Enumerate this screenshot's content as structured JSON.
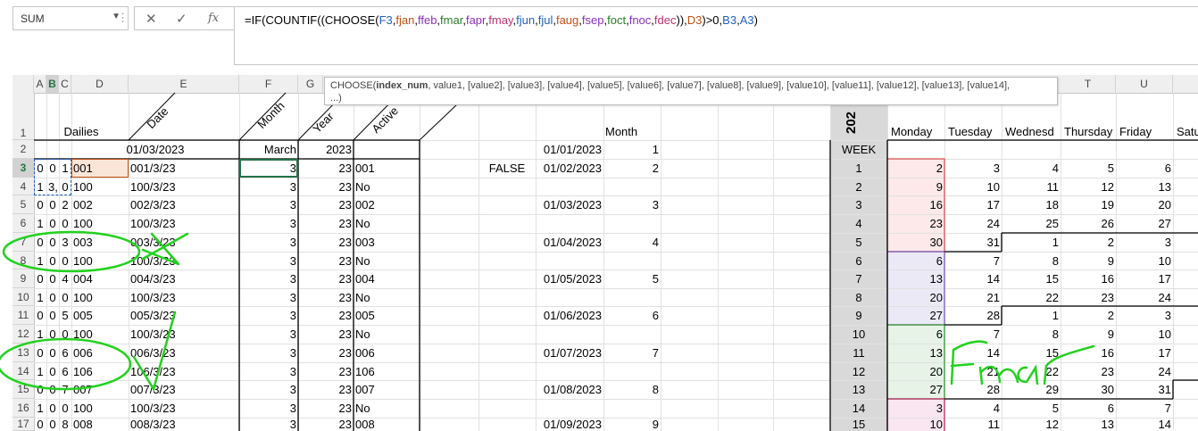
{
  "namebox": {
    "value": "SUM"
  },
  "formula_bar": {
    "cancel_icon": "✕",
    "enter_icon": "✓",
    "fx_label": "fx",
    "formula_parts": [
      {
        "t": "=IF(COUNTIF((CHOOSE(",
        "c": "#000"
      },
      {
        "t": "F3",
        "c": "#1f5fbf"
      },
      {
        "t": ",",
        "c": "#000"
      },
      {
        "t": "fjan",
        "c": "#c04f15"
      },
      {
        "t": ",",
        "c": "#000"
      },
      {
        "t": "ffeb",
        "c": "#8a2fbf"
      },
      {
        "t": ",",
        "c": "#000"
      },
      {
        "t": "fmar",
        "c": "#2a7a2a"
      },
      {
        "t": ",",
        "c": "#000"
      },
      {
        "t": "fapr",
        "c": "#8a2fbf"
      },
      {
        "t": ",",
        "c": "#000"
      },
      {
        "t": "fmay",
        "c": "#c0306b"
      },
      {
        "t": ",",
        "c": "#000"
      },
      {
        "t": "fjun",
        "c": "#1f5fbf"
      },
      {
        "t": ",",
        "c": "#000"
      },
      {
        "t": "fjul",
        "c": "#1f5fbf"
      },
      {
        "t": ",",
        "c": "#000"
      },
      {
        "t": "faug",
        "c": "#c04f15"
      },
      {
        "t": ",",
        "c": "#000"
      },
      {
        "t": "fsep",
        "c": "#8a2fbf"
      },
      {
        "t": ",",
        "c": "#000"
      },
      {
        "t": "foct",
        "c": "#2a7a2a"
      },
      {
        "t": ",",
        "c": "#000"
      },
      {
        "t": "fnoc",
        "c": "#8a2fbf"
      },
      {
        "t": ",",
        "c": "#000"
      },
      {
        "t": "fdec",
        "c": "#c0306b"
      },
      {
        "t": ")),",
        "c": "#000"
      },
      {
        "t": "D3",
        "c": "#c04f15"
      },
      {
        "t": ")>0,",
        "c": "#000"
      },
      {
        "t": "B3",
        "c": "#1f5fbf"
      },
      {
        "t": ",",
        "c": "#000"
      },
      {
        "t": "A3",
        "c": "#1f5fbf"
      },
      {
        "t": ")",
        "c": "#000"
      }
    ]
  },
  "tooltip": {
    "line1_fn": "CHOOSE(",
    "line1_bold": "index_num",
    "line1_rest": ", value1, [value2], [value3], [value4], [value5], [value6], [value7], [value8], [value9], [value10], [value11], [value12], [value13], [value14],",
    "line2": "...)"
  },
  "columns": [
    "A",
    "B",
    "C",
    "D",
    "E",
    "F",
    "G",
    "T",
    "U"
  ],
  "header_row": {
    "dailies": "Dailies",
    "date": "Date",
    "month": "Month",
    "year": "Year",
    "active": "Active",
    "month2": "Month",
    "year_vertical": "202",
    "weekdays": [
      "Monday",
      "Tuesday",
      "Wednesd",
      "Thursday",
      "Friday",
      "Satu"
    ]
  },
  "row2": {
    "date": "01/03/2023",
    "month": "March",
    "year": "2023",
    "ref_date": "01/01/2023",
    "ref_month": "1",
    "week": "WEEK"
  },
  "rows": [
    {
      "n": "3",
      "a": "0",
      "b": "0",
      "c": "1",
      "d": "001",
      "e": "001/3/23",
      "f": "3",
      "g": "23",
      "h": "001",
      "i": "FALSE",
      "j": "01/02/2023",
      "k": "2"
    },
    {
      "n": "4",
      "a": "1",
      "b": "3,",
      "c": "0",
      "d": "100",
      "e": "100/3/23",
      "f": "3",
      "g": "23",
      "h": "No",
      "i": "",
      "j": "",
      "k": ""
    },
    {
      "n": "5",
      "a": "0",
      "b": "0",
      "c": "2",
      "d": "002",
      "e": "002/3/23",
      "f": "3",
      "g": "23",
      "h": "002",
      "i": "",
      "j": "01/03/2023",
      "k": "3"
    },
    {
      "n": "6",
      "a": "1",
      "b": "0",
      "c": "0",
      "d": "100",
      "e": "100/3/23",
      "f": "3",
      "g": "23",
      "h": "No",
      "i": "",
      "j": "",
      "k": ""
    },
    {
      "n": "7",
      "a": "0",
      "b": "0",
      "c": "3",
      "d": "003",
      "e": "003/3/23",
      "f": "3",
      "g": "23",
      "h": "003",
      "i": "",
      "j": "01/04/2023",
      "k": "4"
    },
    {
      "n": "8",
      "a": "1",
      "b": "0",
      "c": "0",
      "d": "100",
      "e": "100/3/23",
      "f": "3",
      "g": "23",
      "h": "No",
      "i": "",
      "j": "",
      "k": ""
    },
    {
      "n": "9",
      "a": "0",
      "b": "0",
      "c": "4",
      "d": "004",
      "e": "004/3/23",
      "f": "3",
      "g": "23",
      "h": "004",
      "i": "",
      "j": "01/05/2023",
      "k": "5"
    },
    {
      "n": "10",
      "a": "1",
      "b": "0",
      "c": "0",
      "d": "100",
      "e": "100/3/23",
      "f": "3",
      "g": "23",
      "h": "No",
      "i": "",
      "j": "",
      "k": ""
    },
    {
      "n": "11",
      "a": "0",
      "b": "0",
      "c": "5",
      "d": "005",
      "e": "005/3/23",
      "f": "3",
      "g": "23",
      "h": "005",
      "i": "",
      "j": "01/06/2023",
      "k": "6"
    },
    {
      "n": "12",
      "a": "1",
      "b": "0",
      "c": "0",
      "d": "100",
      "e": "100/3/23",
      "f": "3",
      "g": "23",
      "h": "No",
      "i": "",
      "j": "",
      "k": ""
    },
    {
      "n": "13",
      "a": "0",
      "b": "0",
      "c": "6",
      "d": "006",
      "e": "006/3/23",
      "f": "3",
      "g": "23",
      "h": "006",
      "i": "",
      "j": "01/07/2023",
      "k": "7"
    },
    {
      "n": "14",
      "a": "1",
      "b": "0",
      "c": "6",
      "d": "106",
      "e": "106/3/23",
      "f": "3",
      "g": "23",
      "h": "106",
      "i": "",
      "j": "",
      "k": ""
    },
    {
      "n": "15",
      "a": "0",
      "b": "0",
      "c": "7",
      "d": "007",
      "e": "007/3/23",
      "f": "3",
      "g": "23",
      "h": "007",
      "i": "",
      "j": "01/08/2023",
      "k": "8"
    },
    {
      "n": "16",
      "a": "1",
      "b": "0",
      "c": "0",
      "d": "100",
      "e": "100/3/23",
      "f": "3",
      "g": "23",
      "h": "No",
      "i": "",
      "j": "",
      "k": ""
    },
    {
      "n": "17",
      "a": "0",
      "b": "0",
      "c": "8",
      "d": "008",
      "e": "008/3/23",
      "f": "3",
      "g": "23",
      "h": "008",
      "i": "",
      "j": "01/09/2023",
      "k": "9"
    }
  ],
  "calendar": [
    {
      "w": "1",
      "d": [
        "2",
        "3",
        "4",
        "5",
        "6"
      ]
    },
    {
      "w": "2",
      "d": [
        "9",
        "10",
        "11",
        "12",
        "13"
      ]
    },
    {
      "w": "3",
      "d": [
        "16",
        "17",
        "18",
        "19",
        "20"
      ]
    },
    {
      "w": "4",
      "d": [
        "23",
        "24",
        "25",
        "26",
        "27"
      ]
    },
    {
      "w": "5",
      "d": [
        "30",
        "31",
        "1",
        "2",
        "3"
      ]
    },
    {
      "w": "6",
      "d": [
        "6",
        "7",
        "8",
        "9",
        "10"
      ]
    },
    {
      "w": "7",
      "d": [
        "13",
        "14",
        "15",
        "16",
        "17"
      ]
    },
    {
      "w": "8",
      "d": [
        "20",
        "21",
        "22",
        "23",
        "24"
      ]
    },
    {
      "w": "9",
      "d": [
        "27",
        "28",
        "1",
        "2",
        "3"
      ]
    },
    {
      "w": "10",
      "d": [
        "6",
        "7",
        "8",
        "9",
        "10"
      ]
    },
    {
      "w": "11",
      "d": [
        "13",
        "14",
        "15",
        "16",
        "17"
      ]
    },
    {
      "w": "12",
      "d": [
        "20",
        "21",
        "22",
        "23",
        "24"
      ]
    },
    {
      "w": "13",
      "d": [
        "27",
        "28",
        "29",
        "30",
        "31"
      ]
    },
    {
      "w": "14",
      "d": [
        "3",
        "4",
        "5",
        "6",
        "7"
      ]
    },
    {
      "w": "15",
      "d": [
        "10",
        "11",
        "12",
        "13",
        "14"
      ]
    }
  ],
  "handwriting": {
    "label": "fmar"
  },
  "colors": {
    "excel_green": "#217346",
    "annotation_green": "#22d11e"
  }
}
